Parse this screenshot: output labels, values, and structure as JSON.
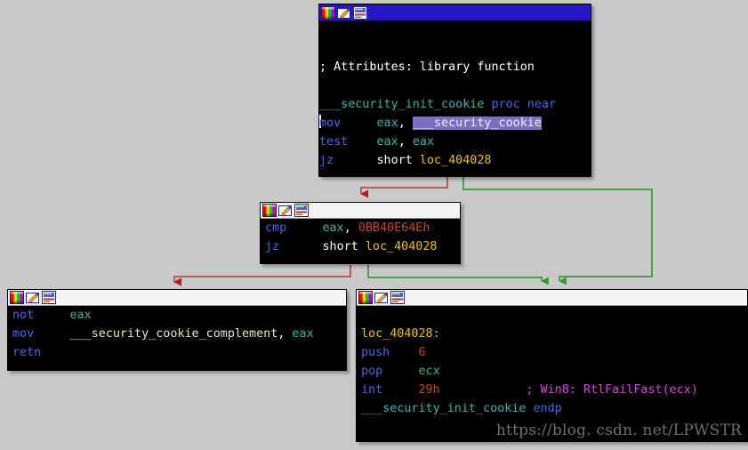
{
  "app": {
    "name": "IDA Pro graph view",
    "background_color": "#c9c9c9"
  },
  "colors": {
    "focused_titlebar": "#2518c4",
    "unfocused_titlebar": "#f4f4f4",
    "node_background": "#000000",
    "edge_false": "#c05a5a",
    "edge_true": "#49a349",
    "mnemonic": "#4466ee",
    "register": "#37b5a8",
    "number": "#cc4422",
    "location": "#f0c000",
    "symbol": "#e6e6c8",
    "comment": "#e040e0",
    "selection": "#7a6fc0"
  },
  "icons": {
    "palette": "color-palette-icon",
    "pencil": "pencil-edit-icon",
    "graph": "graph-window-icon"
  },
  "watermark": "https://blog. csdn. net/LPWSTR",
  "nodes": [
    {
      "id": "block-entry",
      "focused": true,
      "lines": [
        {
          "id": "l1",
          "tokens": []
        },
        {
          "id": "l2",
          "tokens": []
        },
        {
          "id": "l3",
          "tokens": [
            {
              "cls": "c-plain",
              "t": "; Attributes: library function"
            }
          ]
        },
        {
          "id": "l4",
          "tokens": []
        },
        {
          "id": "l5",
          "tokens": [
            {
              "cls": "c-proc",
              "t": "___security_init_cookie "
            },
            {
              "cls": "c-kw",
              "t": "proc near"
            }
          ]
        },
        {
          "id": "l6",
          "tokens": [
            {
              "cls": "caret",
              "t": ""
            },
            {
              "cls": "c-mnem",
              "t": "mov"
            },
            {
              "cls": "c-plain",
              "t": "     "
            },
            {
              "cls": "c-reg",
              "t": "eax"
            },
            {
              "cls": "c-plain",
              "t": ", "
            },
            {
              "cls": "sel",
              "t": "___security_cookie"
            }
          ]
        },
        {
          "id": "l7",
          "tokens": [
            {
              "cls": "c-mnem",
              "t": "test"
            },
            {
              "cls": "c-plain",
              "t": "    "
            },
            {
              "cls": "c-reg",
              "t": "eax"
            },
            {
              "cls": "c-plain",
              "t": ", "
            },
            {
              "cls": "c-reg",
              "t": "eax"
            }
          ]
        },
        {
          "id": "l8",
          "tokens": [
            {
              "cls": "c-mnem",
              "t": "jz"
            },
            {
              "cls": "c-plain",
              "t": "      short "
            },
            {
              "cls": "c-loc",
              "t": "loc_404028"
            }
          ]
        }
      ]
    },
    {
      "id": "block-cmp",
      "focused": false,
      "lines": [
        {
          "id": "m1",
          "tokens": [
            {
              "cls": "c-mnem",
              "t": "cmp"
            },
            {
              "cls": "c-plain",
              "t": "     "
            },
            {
              "cls": "c-reg",
              "t": "eax"
            },
            {
              "cls": "c-plain",
              "t": ", "
            },
            {
              "cls": "c-num",
              "t": "0BB40E64Eh"
            }
          ]
        },
        {
          "id": "m2",
          "tokens": [
            {
              "cls": "c-mnem",
              "t": "jz"
            },
            {
              "cls": "c-plain",
              "t": "      short "
            },
            {
              "cls": "c-loc",
              "t": "loc_404028"
            }
          ]
        }
      ]
    },
    {
      "id": "block-complement",
      "focused": false,
      "lines": [
        {
          "id": "b1",
          "tokens": [
            {
              "cls": "c-mnem",
              "t": "not"
            },
            {
              "cls": "c-plain",
              "t": "     "
            },
            {
              "cls": "c-reg",
              "t": "eax"
            }
          ]
        },
        {
          "id": "b2",
          "tokens": [
            {
              "cls": "c-mnem",
              "t": "mov"
            },
            {
              "cls": "c-plain",
              "t": "     "
            },
            {
              "cls": "c-sym",
              "t": "___security_cookie_complement"
            },
            {
              "cls": "c-plain",
              "t": ", "
            },
            {
              "cls": "c-reg",
              "t": "eax"
            }
          ]
        },
        {
          "id": "b3",
          "tokens": [
            {
              "cls": "c-mnem",
              "t": "retn"
            }
          ]
        }
      ]
    },
    {
      "id": "block-fail",
      "focused": false,
      "lines": [
        {
          "id": "f0",
          "tokens": []
        },
        {
          "id": "f1",
          "tokens": [
            {
              "cls": "c-loc",
              "t": "loc_404028:"
            }
          ]
        },
        {
          "id": "f2",
          "tokens": [
            {
              "cls": "c-mnem",
              "t": "push"
            },
            {
              "cls": "c-plain",
              "t": "    "
            },
            {
              "cls": "c-num",
              "t": "6"
            }
          ]
        },
        {
          "id": "f3",
          "tokens": [
            {
              "cls": "c-mnem",
              "t": "pop"
            },
            {
              "cls": "c-plain",
              "t": "     "
            },
            {
              "cls": "c-reg",
              "t": "ecx"
            }
          ]
        },
        {
          "id": "f4",
          "tokens": [
            {
              "cls": "c-mnem",
              "t": "int"
            },
            {
              "cls": "c-plain",
              "t": "     "
            },
            {
              "cls": "c-num",
              "t": "29h"
            },
            {
              "cls": "c-plain",
              "t": "            "
            },
            {
              "cls": "c-cmt",
              "t": "; Win8: RtlFailFast(ecx)"
            }
          ]
        },
        {
          "id": "f5",
          "tokens": [
            {
              "cls": "c-proc",
              "t": "___security_init_cookie "
            },
            {
              "cls": "c-kw",
              "t": "endp"
            }
          ]
        }
      ]
    }
  ],
  "edges": [
    {
      "id": "edge-entry-false",
      "from": "block-entry",
      "to": "block-cmp",
      "type": "false",
      "color": "#c05a5a"
    },
    {
      "id": "edge-entry-true",
      "from": "block-entry",
      "to": "block-fail",
      "type": "true",
      "color": "#49a349"
    },
    {
      "id": "edge-cmp-false",
      "from": "block-cmp",
      "to": "block-complement",
      "type": "false",
      "color": "#c05a5a"
    },
    {
      "id": "edge-cmp-true",
      "from": "block-cmp",
      "to": "block-fail",
      "type": "true",
      "color": "#49a349"
    }
  ]
}
